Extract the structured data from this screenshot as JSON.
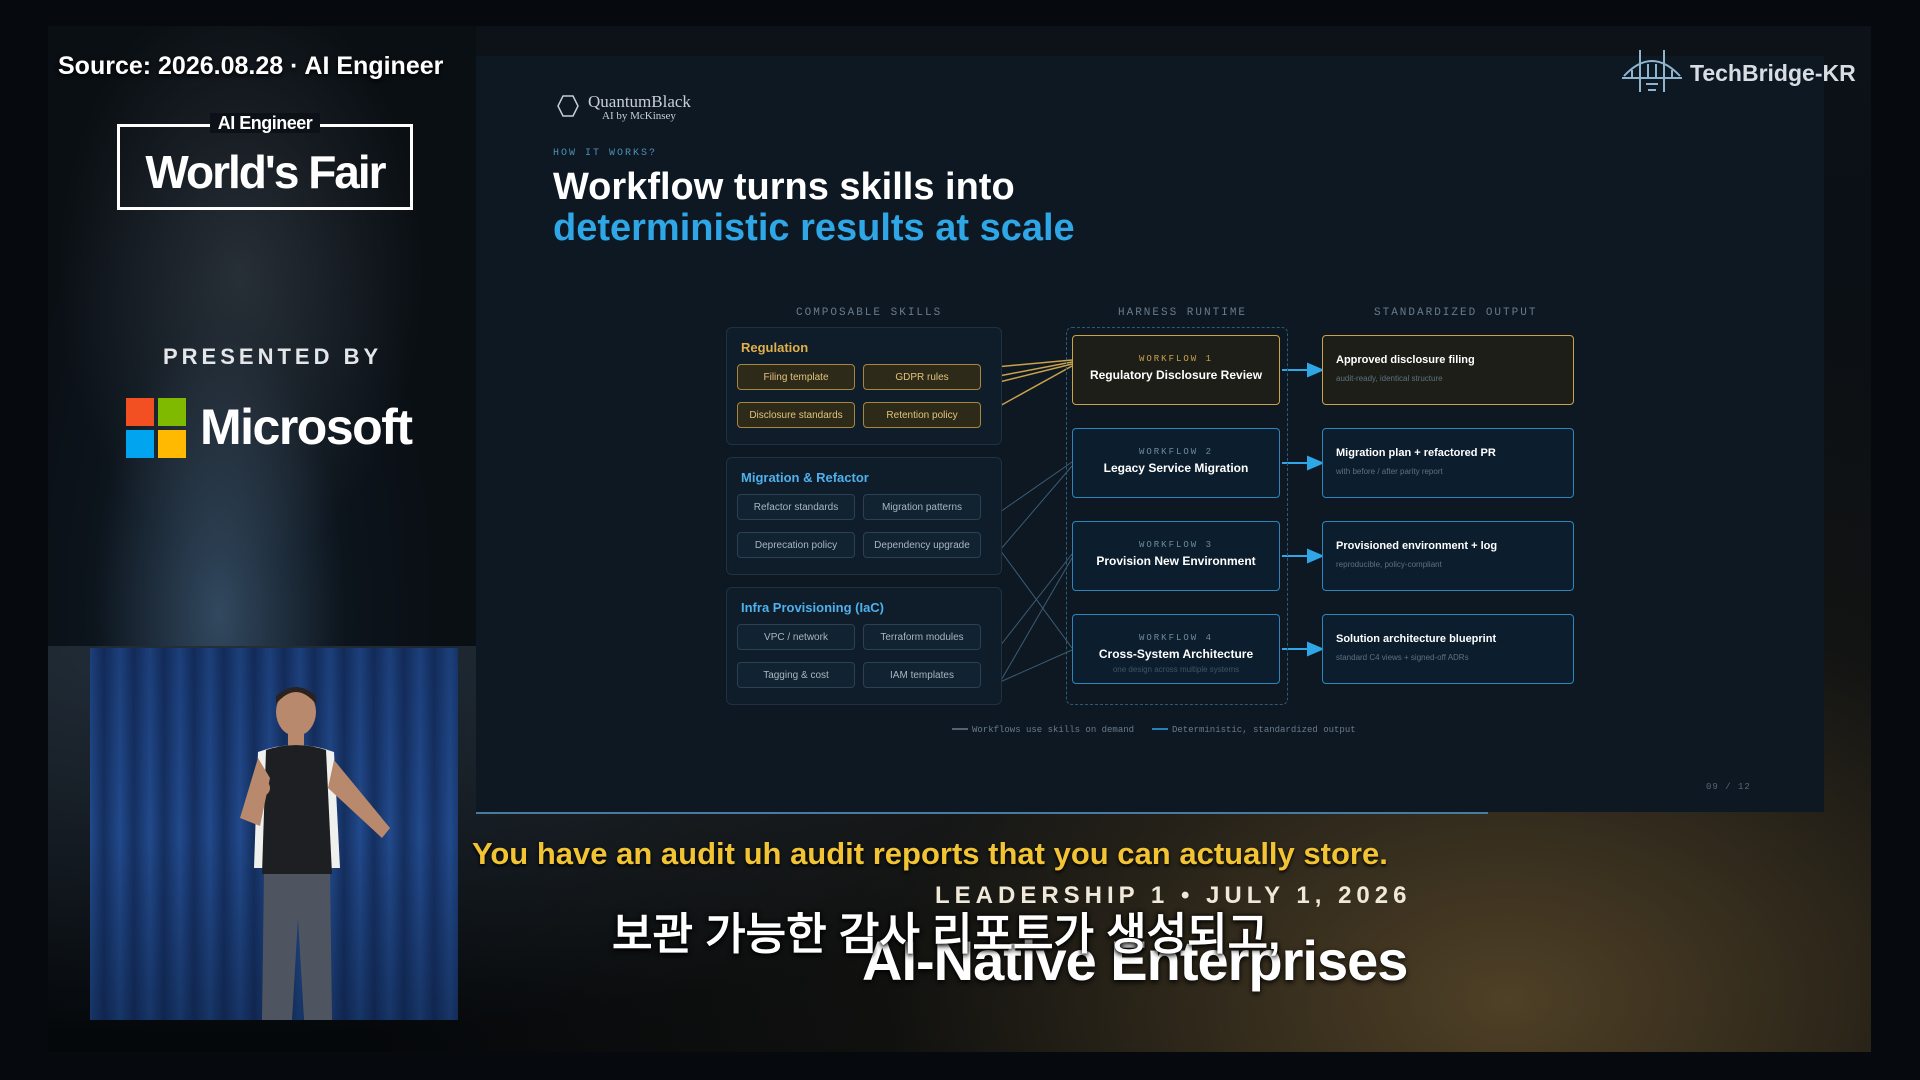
{
  "overlay": {
    "source": "Source: 2026.08.28 · AI Engineer",
    "event_small": "AI Engineer",
    "event_big": "World's Fair",
    "presented_by": "PRESENTED BY",
    "sponsor": "Microsoft",
    "channel": "TechBridge-KR"
  },
  "slide": {
    "brand": "QuantumBlack",
    "brand_sub": "AI by McKinsey",
    "eyebrow": "HOW IT WORKS?",
    "title_line1": "Workflow turns skills into",
    "title_line2": "deterministic results at scale",
    "columns": {
      "skills": "COMPOSABLE SKILLS",
      "runtime": "HARNESS RUNTIME",
      "output": "STANDARDIZED OUTPUT"
    },
    "groups": [
      {
        "title": "Regulation",
        "chips": [
          "Filing template",
          "GDPR rules",
          "Disclosure standards",
          "Retention policy"
        ]
      },
      {
        "title": "Migration & Refactor",
        "chips": [
          "Refactor standards",
          "Migration patterns",
          "Deprecation policy",
          "Dependency upgrade"
        ]
      },
      {
        "title": "Infra Provisioning (IaC)",
        "chips": [
          "VPC / network",
          "Terraform modules",
          "Tagging & cost",
          "IAM templates"
        ]
      }
    ],
    "workflows": [
      {
        "label": "WORKFLOW 1",
        "title": "Regulatory Disclosure Review",
        "sub": ""
      },
      {
        "label": "WORKFLOW 2",
        "title": "Legacy Service Migration",
        "sub": ""
      },
      {
        "label": "WORKFLOW 3",
        "title": "Provision New Environment",
        "sub": ""
      },
      {
        "label": "WORKFLOW 4",
        "title": "Cross-System Architecture",
        "sub": "one design across multiple systems"
      }
    ],
    "outputs": [
      {
        "title": "Approved disclosure filing",
        "sub": "audit-ready, identical structure"
      },
      {
        "title": "Migration plan + refactored PR",
        "sub": "with before / after parity report"
      },
      {
        "title": "Provisioned environment + log",
        "sub": "reproducible, policy-compliant"
      },
      {
        "title": "Solution architecture blueprint",
        "sub": "standard C4 views + signed-off ADRs"
      }
    ],
    "legend": [
      "Workflows use skills on demand",
      "Deterministic, standardized output"
    ],
    "page": "09 / 12"
  },
  "captions": {
    "english": "You have an audit uh audit reports that you can actually store.",
    "korean": "보관 가능한 감사 리포트가 생성되고,",
    "background_line": "LEADERSHIP 1 • JULY 1, 2026",
    "background_title": "AI-Native Enterprises"
  },
  "colors": {
    "accent_blue": "#2fa6e6",
    "gold": "#c9a24a",
    "caption_yellow": "#f2c433"
  }
}
